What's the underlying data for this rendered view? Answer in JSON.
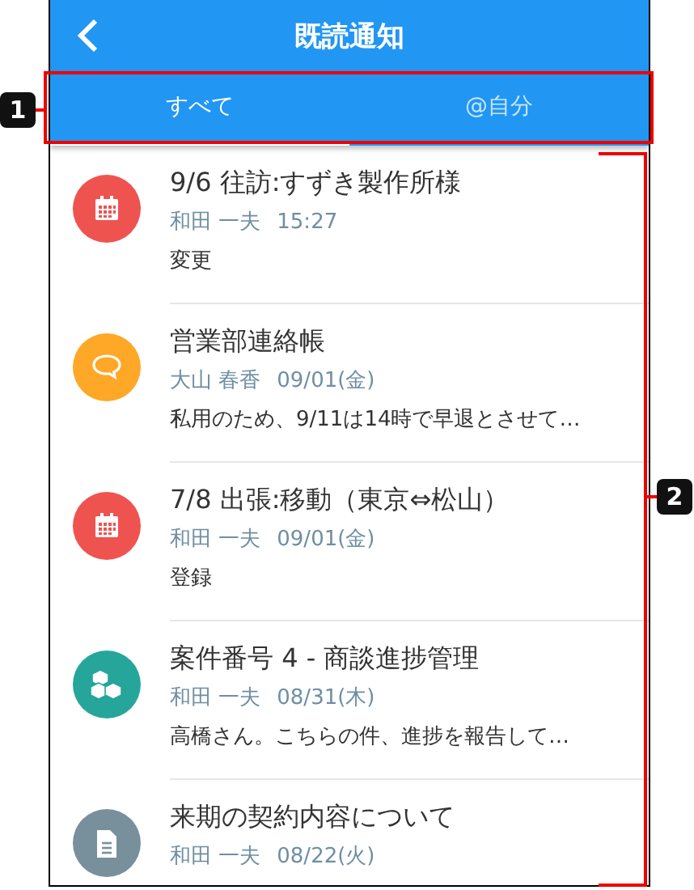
{
  "header": {
    "title": "既読通知"
  },
  "tabs": [
    {
      "label": "すべて",
      "selected": true
    },
    {
      "label": "@自分",
      "selected": false
    }
  ],
  "notifications": [
    {
      "kind": "calendar",
      "color": "#ef5350",
      "title": "9/6 往訪:すずき製作所様",
      "sender": "和田 一夫",
      "time": "15:27",
      "body": "変更"
    },
    {
      "kind": "chat",
      "color": "#ffa726",
      "title": "営業部連絡帳",
      "sender": "大山 春香",
      "time": "09/01(金)",
      "body": "私用のため、9/11は14時で早退とさせて…"
    },
    {
      "kind": "calendar",
      "color": "#ef5350",
      "title": "7/8 出張:移動（東京⇔松山）",
      "sender": "和田 一夫",
      "time": "09/01(金)",
      "body": "登録"
    },
    {
      "kind": "cubes",
      "color": "#26a69a",
      "title": "案件番号 4 - 商談進捗管理",
      "sender": "和田 一夫",
      "time": "08/31(木)",
      "body": "高橋さん。こちらの件、進捗を報告して…"
    },
    {
      "kind": "document",
      "color": "#78909c",
      "title": "来期の契約内容について",
      "sender": "和田 一夫",
      "time": "08/22(火)"
    }
  ],
  "annotations": [
    {
      "label": "1",
      "kind": "box"
    },
    {
      "label": "2",
      "kind": "bracket"
    }
  ]
}
